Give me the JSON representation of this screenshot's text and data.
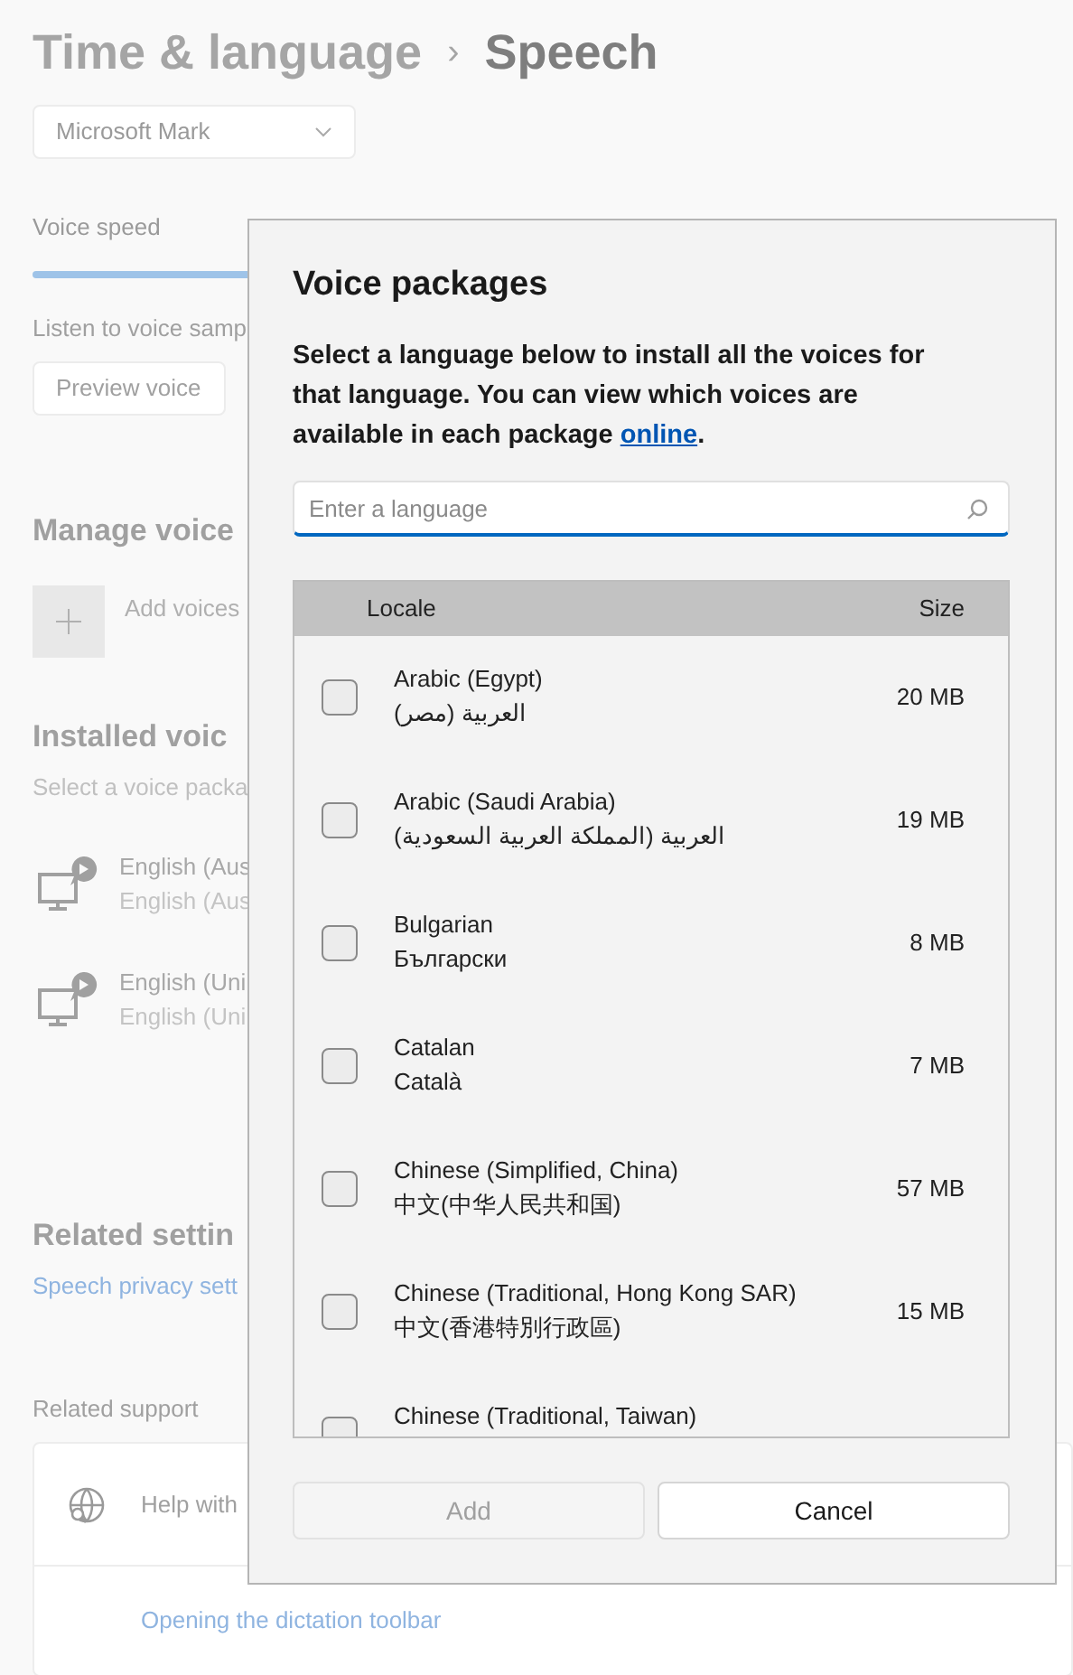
{
  "breadcrumb": {
    "parent": "Time & language",
    "separator": "›",
    "current": "Speech"
  },
  "voice_dropdown": {
    "value": "Microsoft Mark"
  },
  "voice_speed": {
    "label": "Voice speed"
  },
  "listen_label": "Listen to voice samp",
  "preview_button": "Preview voice",
  "manage_heading": "Manage voice",
  "add_voices": "Add voices",
  "installed_heading": "Installed voic",
  "installed_hint": "Select a voice packa",
  "installed_voices": [
    {
      "name": "English (Aus",
      "detail": "English (Aus"
    },
    {
      "name": "English (Uni",
      "detail": "English (Uni"
    }
  ],
  "related_heading": "Related settin",
  "related_link": "Speech privacy sett",
  "support_heading": "Related support",
  "support_items": [
    {
      "kind": "expander",
      "label": "Help with"
    },
    {
      "kind": "link",
      "label": "Opening the dictation toolbar"
    }
  ],
  "dialog": {
    "title": "Voice packages",
    "description": "Select a language below to install all the voices for that language. You can view which voices are available in each package ",
    "link": "online",
    "after_link": ".",
    "search": {
      "placeholder": "Enter a language"
    },
    "columns": [
      "Locale",
      "Size"
    ],
    "rows": [
      {
        "name": "Arabic (Egypt)",
        "native": "العربية (مصر)",
        "size": "20 MB",
        "checked": false
      },
      {
        "name": "Arabic (Saudi Arabia)",
        "native": "العربية (المملكة العربية السعودية)",
        "size": "19 MB",
        "checked": false
      },
      {
        "name": "Bulgarian",
        "native": "Български",
        "size": "8 MB",
        "checked": false
      },
      {
        "name": "Catalan",
        "native": "Català",
        "size": "7 MB",
        "checked": false
      },
      {
        "name": "Chinese (Simplified, China)",
        "native": "中文(中华人民共和国)",
        "size": "57 MB",
        "checked": false
      },
      {
        "name": "Chinese (Traditional, Hong Kong SAR)",
        "native": "中文(香港特別行政區)",
        "size": "15 MB",
        "checked": false
      },
      {
        "name": "Chinese (Traditional, Taiwan)",
        "checked": false
      }
    ],
    "buttons": [
      {
        "label": "Add",
        "disabled": true
      },
      {
        "label": "Cancel",
        "disabled": false
      }
    ]
  }
}
